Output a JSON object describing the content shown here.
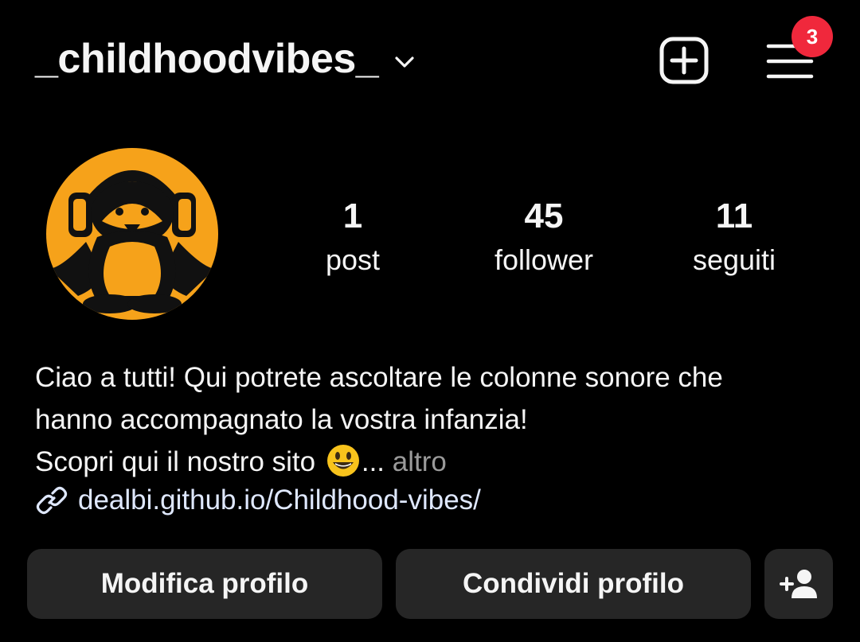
{
  "header": {
    "username": "_childhoodvibes_",
    "notification_count": "3",
    "icons": {
      "username_dropdown": "chevron-down-icon",
      "create": "plus-square-icon",
      "menu": "hamburger-menu-icon"
    }
  },
  "profile": {
    "avatar_icon": "penguin-headphones-logo",
    "stats": [
      {
        "value": "1",
        "label": "post"
      },
      {
        "value": "45",
        "label": "follower"
      },
      {
        "value": "11",
        "label": "seguiti"
      }
    ]
  },
  "bio": {
    "line1": "Ciao a tutti! Qui potrete ascoltare le colonne sonore che",
    "line2": "hanno accompagnato la vostra infanzia!",
    "line3": "Scopri qui il nostro sito",
    "ellipsis": "...",
    "more_label": "altro",
    "link": "dealbi.github.io/Childhood-vibes/"
  },
  "actions": {
    "edit_profile": "Modifica profilo",
    "share_profile": "Condividi profilo",
    "add_user_icon": "add-person-icon"
  },
  "colors": {
    "background": "#000000",
    "badge": "#f0283c",
    "button_bg": "#262626",
    "avatar_bg": "#f6a21a",
    "link": "#dfe8ff",
    "muted": "#9a9a9a"
  }
}
